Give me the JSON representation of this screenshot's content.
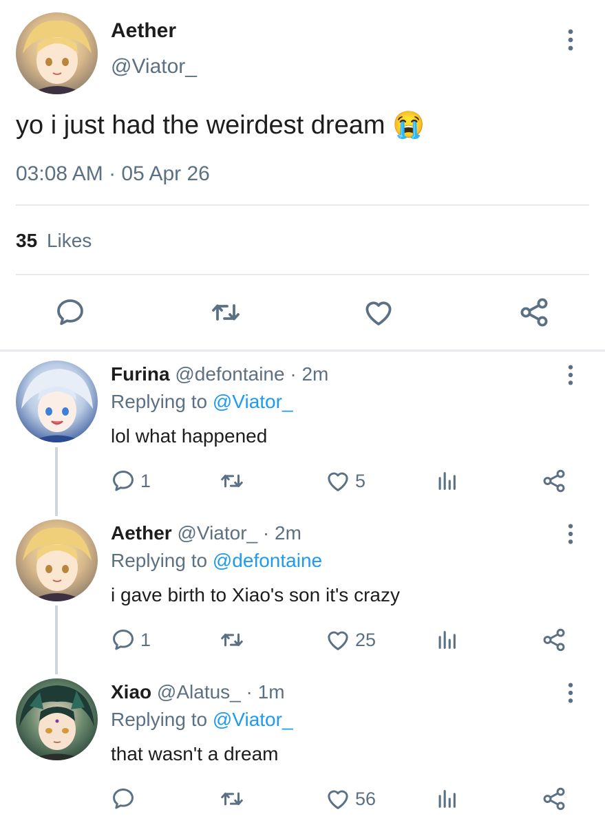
{
  "main_tweet": {
    "author_name": "Aether",
    "handle": "@Viator_",
    "text": "yo i just had the weirdest dream",
    "emoji": "😭",
    "timestamp": "03:08 AM · 05 Apr 26",
    "likes_count": "35",
    "likes_label": "Likes",
    "avatar_icon": "aether-avatar"
  },
  "replies": [
    {
      "author_name": "Furina",
      "handle": "@defontaine",
      "time": "· 2m",
      "replying_label": "Replying to",
      "replying_to": "@Viator_",
      "text": "lol what happened",
      "reply_count": "1",
      "like_count": "5",
      "avatar_icon": "furina-avatar"
    },
    {
      "author_name": "Aether",
      "handle": "@Viator_",
      "time": "· 2m",
      "replying_label": "Replying to",
      "replying_to": "@defontaine",
      "text": "i gave birth to Xiao's son it's crazy",
      "reply_count": "1",
      "like_count": "25",
      "avatar_icon": "aether-avatar"
    },
    {
      "author_name": "Xiao",
      "handle": "@Alatus_",
      "time": "· 1m",
      "replying_label": "Replying to",
      "replying_to": "@Viator_",
      "text": "that wasn't a dream",
      "reply_count": "",
      "like_count": "56",
      "avatar_icon": "xiao-avatar"
    }
  ],
  "colors": {
    "muted": "#5b7083",
    "link": "#1d9bf0",
    "divider": "#e6e9ec",
    "thread_line": "#cfd5da"
  }
}
